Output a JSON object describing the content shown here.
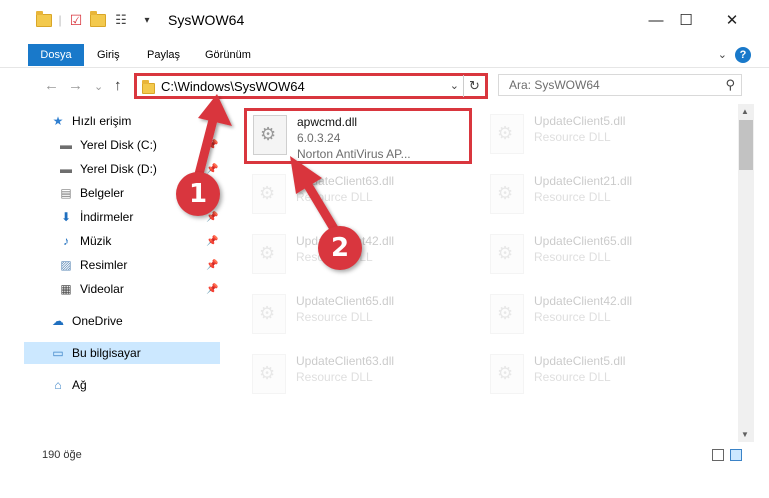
{
  "window": {
    "title": "SysWOW64",
    "minimize_glyph": "—",
    "maximize_glyph": "☐",
    "close_glyph": "✕"
  },
  "ribbon": {
    "tabs": [
      {
        "label": "Dosya",
        "active": true
      },
      {
        "label": "Giriş"
      },
      {
        "label": "Paylaş"
      },
      {
        "label": "Görünüm"
      }
    ],
    "help": "?",
    "expand_glyph": "⌄"
  },
  "address": {
    "path": "C:\\Windows\\SysWOW64",
    "search_placeholder": "Ara: SysWOW64",
    "back_glyph": "←",
    "forward_glyph": "→",
    "recent_glyph": "⌄",
    "up_glyph": "↑",
    "dropdown_glyph": "⌄",
    "refresh_glyph": "↻",
    "search_glyph": "⚲"
  },
  "navpane": {
    "items": [
      {
        "label": "Hızlı erişim",
        "icon": "star-icon",
        "glyph": "★",
        "color": "#2f7fd0"
      },
      {
        "label": "Yerel Disk (C:)",
        "icon": "drive-icon",
        "glyph": "▬",
        "color": "#6e6e6e",
        "pinned": true
      },
      {
        "label": "Yerel Disk (D:)",
        "icon": "drive-icon",
        "glyph": "▬",
        "color": "#6e6e6e",
        "pinned": true
      },
      {
        "label": "Belgeler",
        "icon": "documents-icon",
        "glyph": "▤",
        "color": "#7b7b7b",
        "pinned": true
      },
      {
        "label": "İndirmeler",
        "icon": "download-icon",
        "glyph": "⬇",
        "color": "#1f6fbf",
        "pinned": true
      },
      {
        "label": "Müzik",
        "icon": "music-icon",
        "glyph": "♪",
        "color": "#1f6fbf",
        "pinned": true
      },
      {
        "label": "Resimler",
        "icon": "pictures-icon",
        "glyph": "▨",
        "color": "#5a87b5",
        "pinned": true
      },
      {
        "label": "Videolar",
        "icon": "videos-icon",
        "glyph": "▦",
        "color": "#4d4d4d",
        "pinned": true
      },
      {
        "label": "OneDrive",
        "icon": "cloud-icon",
        "glyph": "☁",
        "color": "#1f6fbf"
      },
      {
        "label": "Bu bilgisayar",
        "icon": "computer-icon",
        "glyph": "▭",
        "color": "#3b83c7",
        "selected": true
      },
      {
        "label": "Ağ",
        "icon": "network-icon",
        "glyph": "⌂",
        "color": "#3b83c7"
      }
    ],
    "pin_glyph": "📌"
  },
  "files": [
    {
      "name": "apwcmd.dll",
      "line1": "6.0.3.24",
      "line2": "Norton AntiVirus AP...",
      "highlighted": true
    },
    {
      "name": "UpdateClient5.dll",
      "line1": "Resource DLL",
      "faded": true
    },
    {
      "name": "UpdateClient63.dll",
      "line1": "Resource DLL",
      "faded": true
    },
    {
      "name": "UpdateClient21.dll",
      "line1": "Resource DLL",
      "faded": true
    },
    {
      "name": "UpdateClient42.dll",
      "line1": "Resource DLL",
      "faded": true
    },
    {
      "name": "UpdateClient65.dll",
      "line1": "Resource DLL",
      "faded": true
    },
    {
      "name": "UpdateClient65.dll",
      "line1": "Resource DLL",
      "faded": true
    },
    {
      "name": "UpdateClient42.dll",
      "line1": "Resource DLL",
      "faded": true
    },
    {
      "name": "UpdateClient63.dll",
      "line1": "Resource DLL",
      "faded": true
    },
    {
      "name": "UpdateClient5.dll",
      "line1": "Resource DLL",
      "faded": true
    }
  ],
  "status": {
    "item_count": "190 öğe"
  },
  "callouts": {
    "step1": "1",
    "step2": "2"
  },
  "colors": {
    "accent": "#1979ca",
    "callout_red": "#d9363e",
    "selection": "#cce8ff"
  }
}
